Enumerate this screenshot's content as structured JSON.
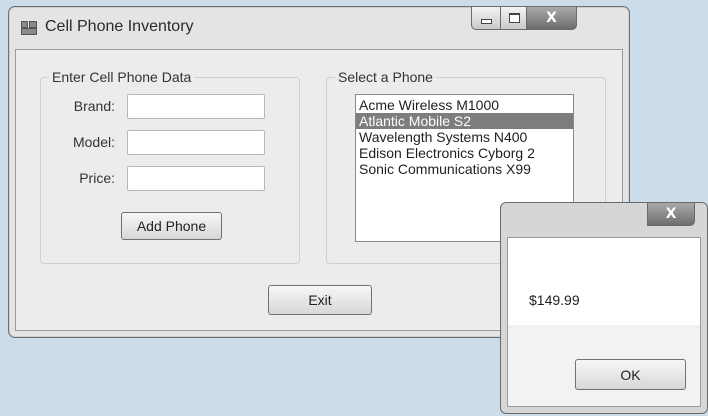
{
  "window": {
    "title": "Cell Phone Inventory"
  },
  "data_entry": {
    "group_title": "Enter Cell Phone Data",
    "fields": [
      {
        "label": "Brand:",
        "value": ""
      },
      {
        "label": "Model:",
        "value": ""
      },
      {
        "label": "Price:",
        "value": ""
      }
    ],
    "add_button": "Add Phone"
  },
  "phone_select": {
    "group_title": "Select a Phone",
    "items": [
      "Acme Wireless M1000",
      "Atlantic Mobile S2",
      "Wavelength Systems N400",
      "Edison Electronics Cyborg 2",
      "Sonic Communications X99"
    ],
    "selected_index": 1
  },
  "exit_button": "Exit",
  "message_box": {
    "text": "$149.99",
    "ok_button": "OK"
  },
  "colors": {
    "selection": "#7d7d7d",
    "background": "#ccdce9"
  },
  "icons": {
    "app": "window-app-icon",
    "minimize": "minimize-icon",
    "maximize": "maximize-icon",
    "close": "close-icon"
  }
}
